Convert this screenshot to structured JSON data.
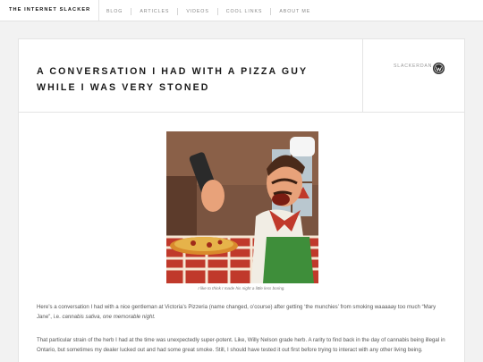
{
  "site": {
    "title": "THE INTERNET SLACKER",
    "nav": [
      "BLOG",
      "ARTICLES",
      "VIDEOS",
      "COOL LINKS",
      "ABOUT ME"
    ]
  },
  "post": {
    "title": "A CONVERSATION I HAD WITH A PIZZA GUY WHILE I WAS VERY STONED",
    "author": "SLACKERDAN",
    "image_caption": "I like to think I made his night a little less boring.",
    "p1_a": "Here’s a conversation I had with a nice gentleman at Victoria’s Pizzeria (name changed, o’course) after getting ‘the munchies’ from smoking waaaaay too much “Mary Jane”, i.e. ",
    "p1_em": "cannabis sativa, one memorable night.",
    "p2": "That particular strain of the herb I had at the time was unexpectedly super-potent. Like, Willy Nelson grade herb. A rarity to find back in the day of cannabis being illegal in Ontario, but sometimes my dealer lucked out and had some great smoke. Still, I should have tested it out first before trying to interact with any other living being."
  },
  "colors": {
    "accent": "#1a1a1a",
    "nav_text": "#8a8a8a",
    "background": "#f2f2f2"
  },
  "icons": {
    "author_avatar": "wordpress-logo-icon"
  }
}
